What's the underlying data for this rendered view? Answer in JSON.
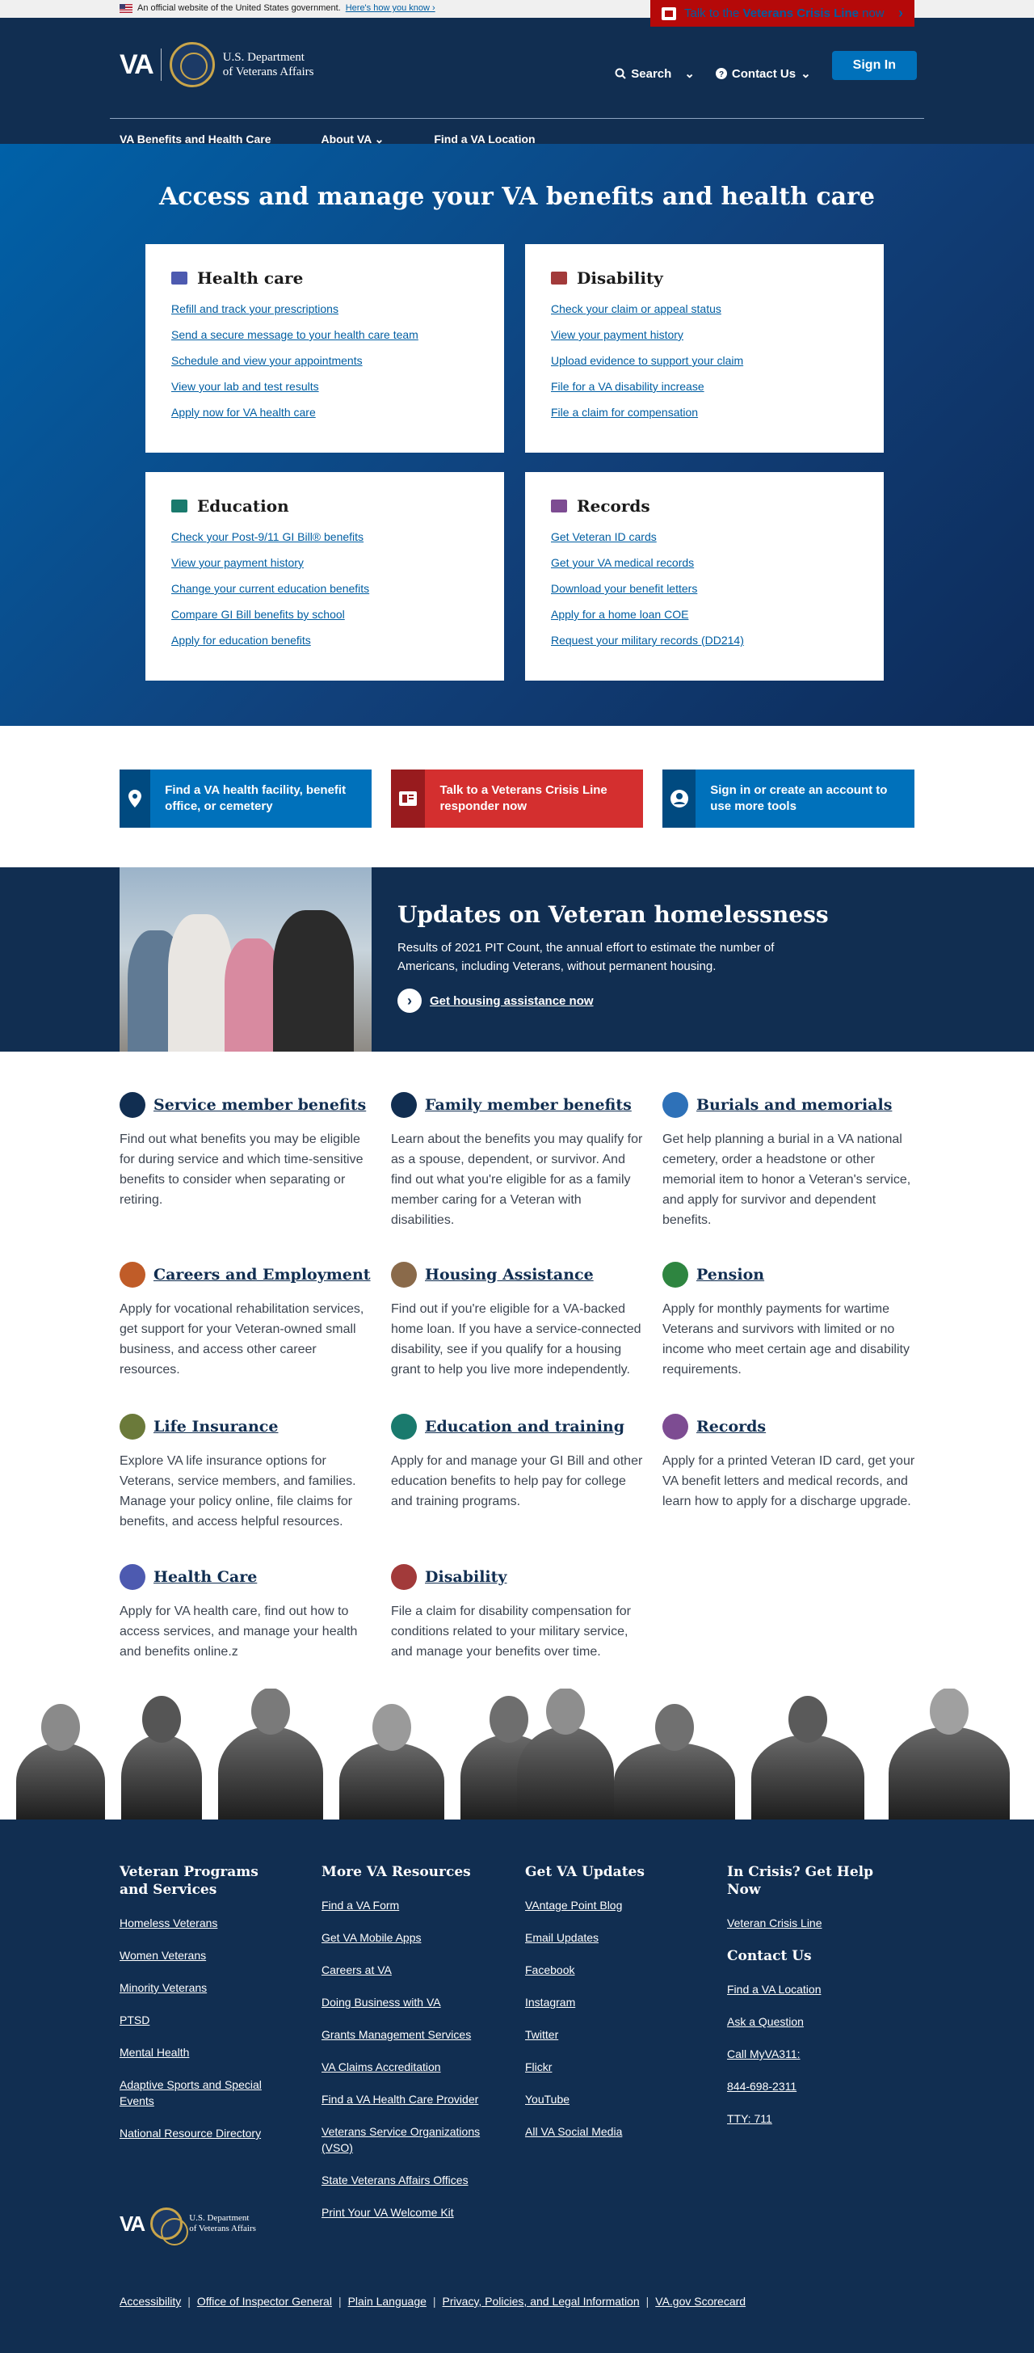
{
  "gov_banner": {
    "text": "An official website of the United States government.",
    "link": "Here's how you know"
  },
  "crisis_top": {
    "prefix": "Talk to the ",
    "bold": "Veterans Crisis Line",
    "suffix": " now"
  },
  "header": {
    "logo_text": "VA",
    "dept_line1": "U.S. Department",
    "dept_line2": "of Veterans Affairs",
    "search": "Search",
    "contact": "Contact Us",
    "sign_in": "Sign In",
    "nav": [
      "VA Benefits and Health Care",
      "About VA",
      "Find a VA Location"
    ]
  },
  "hero": {
    "title": "Access and manage your VA benefits and health care",
    "cards": [
      {
        "title": "Health care",
        "icon": "medkit-icon",
        "color": "#4d5ab0",
        "links": [
          "Refill and track your prescriptions",
          "Send a secure message to your health care team",
          "Schedule and view your appointments",
          "View your lab and test results",
          "Apply now for VA health care"
        ]
      },
      {
        "title": "Disability",
        "icon": "file-icon",
        "color": "#a23a3a",
        "links": [
          "Check your claim or appeal status",
          "View your payment history",
          "Upload evidence to support your claim",
          "File for a VA disability increase",
          "File a claim for compensation"
        ]
      },
      {
        "title": "Education",
        "icon": "graduation-cap-icon",
        "color": "#1a7a6d",
        "links": [
          "Check your Post-9/11 GI Bill® benefits",
          "View your payment history",
          "Change your current education benefits",
          "Compare GI Bill benefits by school",
          "Apply for education benefits"
        ]
      },
      {
        "title": "Records",
        "icon": "id-card-icon",
        "color": "#7d4c92",
        "links": [
          "Get Veteran ID cards",
          "Get your VA medical records",
          "Download your benefit letters",
          "Apply for a home loan COE",
          "Request your military records (DD214)"
        ]
      }
    ]
  },
  "actions": [
    {
      "label": "Find a VA health facility, benefit office, or cemetery",
      "icon": "map-marker-icon",
      "color": "#0071bb",
      "dark": "#004a80"
    },
    {
      "label": "Talk to a Veterans Crisis Line responder now",
      "icon": "crisis-line-icon",
      "color": "#d42f2f",
      "dark": "#981b1e"
    },
    {
      "label": "Sign in or create an account to use more tools",
      "icon": "user-circle-icon",
      "color": "#0071bb",
      "dark": "#004a80"
    }
  ],
  "homeless": {
    "title": "Updates on Veteran homelessness",
    "text": "Results of 2021 PIT Count, the annual effort to estimate the number of Americans, including Veterans, without permanent housing.",
    "link": "Get housing assistance now"
  },
  "hubs": [
    {
      "title": "Service member benefits",
      "icon": "flag-icon",
      "color": "#112e51",
      "text": "Find out what benefits you may be eligible for during service and which time-sensitive benefits to consider when separating or retiring."
    },
    {
      "title": "Family member benefits",
      "icon": "users-icon",
      "color": "#112e51",
      "text": "Learn about the benefits you may qualify for as a spouse, dependent, or survivor. And find out what you're eligible for as a family member caring for a Veteran with disabilities."
    },
    {
      "title": "Burials and memorials",
      "icon": "star-icon",
      "color": "#2e71b8",
      "text": "Get help planning a burial in a VA national cemetery, order a headstone or other memorial item to honor a Veteran's service, and apply for survivor and dependent benefits."
    },
    {
      "title": "Careers and Employment",
      "icon": "briefcase-icon",
      "color": "#c05c28",
      "text": "Apply for vocational rehabilitation services, get support for your Veteran-owned small business, and access other career resources."
    },
    {
      "title": "Housing Assistance",
      "icon": "home-icon",
      "color": "#8a6a4a",
      "text": "Find out if you're eligible for a VA-backed home loan. If you have a service-connected disability, see if you qualify for a housing grant to help you live more independently."
    },
    {
      "title": "Pension",
      "icon": "handshake-icon",
      "color": "#2e8540",
      "text": "Apply for monthly payments for wartime Veterans and survivors with limited or no income who meet certain age and disability requirements."
    },
    {
      "title": "Life Insurance",
      "icon": "shield-icon",
      "color": "#6b7a3a",
      "text": "Explore VA life insurance options for Veterans, service members, and families. Manage your policy online, file claims for benefits, and access helpful resources."
    },
    {
      "title": "Education and training",
      "icon": "graduation-cap-icon",
      "color": "#1a7a6d",
      "text": "Apply for and manage your GI Bill and other education benefits to help pay for college and training programs."
    },
    {
      "title": "Records",
      "icon": "id-card-icon",
      "color": "#7d4c92",
      "text": "Apply for a printed Veteran ID card, get your VA benefit letters and medical records, and learn how to apply for a discharge upgrade."
    },
    {
      "title": "Health Care",
      "icon": "medkit-icon",
      "color": "#4d5ab0",
      "text": "Apply for VA health care, find out how to access services, and manage your health and benefits online.z"
    },
    {
      "title": "Disability",
      "icon": "file-icon",
      "color": "#a23a3a",
      "text": "File a claim for disability compensation for conditions related to your military service, and manage your benefits over time."
    }
  ],
  "footer": {
    "columns": [
      {
        "title": "Veteran Programs and Services",
        "links": [
          "Homeless Veterans",
          "Women Veterans",
          "Minority Veterans",
          "PTSD",
          "Mental Health",
          "Adaptive Sports and Special Events",
          "National Resource Directory"
        ]
      },
      {
        "title": "More VA Resources",
        "links": [
          "Find a VA Form",
          "Get VA Mobile Apps",
          "Careers at VA",
          "Doing Business with VA",
          "Grants Management Services",
          "VA Claims Accreditation",
          "Find a VA Health Care Provider",
          "Veterans Service Organizations (VSO)",
          "State Veterans Affairs Offices",
          "Print Your VA Welcome Kit"
        ]
      },
      {
        "title": "Get VA Updates",
        "links": [
          "VAntage Point Blog",
          "Email Updates",
          "Facebook",
          "Instagram",
          "Twitter",
          "Flickr",
          "YouTube",
          "All VA Social Media"
        ]
      },
      {
        "title": "In Crisis? Get Help Now",
        "links": [
          "Veteran Crisis Line"
        ]
      }
    ],
    "contact": {
      "title": "Contact Us",
      "links": [
        "Find a VA Location",
        "Ask a Question",
        "Call MyVA311:",
        "844-698-2311",
        "TTY: 711"
      ]
    },
    "bottom_links": [
      "Accessibility",
      "Office of Inspector General",
      "Plain Language",
      "Privacy, Policies, and Legal Information",
      "VA.gov Scorecard"
    ]
  }
}
